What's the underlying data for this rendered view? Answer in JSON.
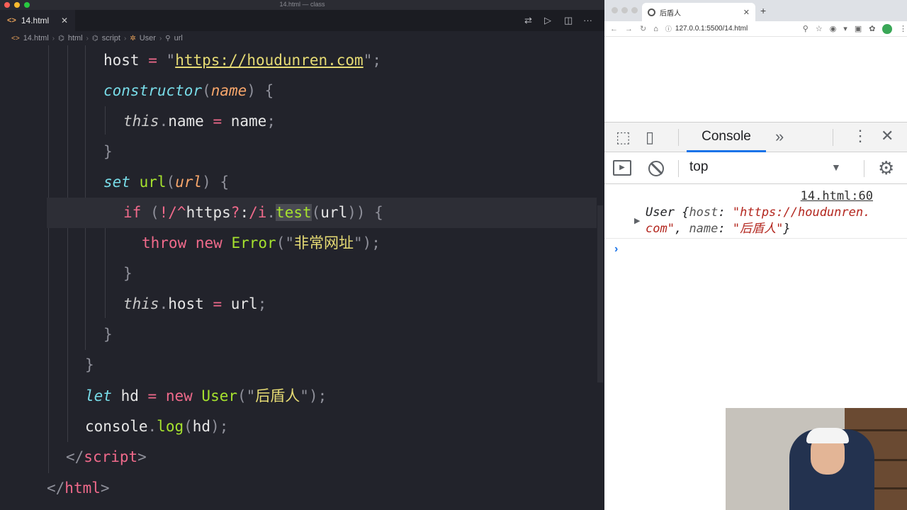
{
  "editor": {
    "window_title": "14.html — class",
    "tab": {
      "icon": "<>",
      "label": "14.html",
      "close": "✕"
    },
    "breadcrumb": [
      "14.html",
      "html",
      "script",
      "User",
      "url"
    ],
    "toolbar_icons": [
      "split-compare-icon",
      "run-icon",
      "split-editor-icon",
      "more-icon"
    ]
  },
  "browser": {
    "tab_title": "后盾人",
    "tab_close": "✕",
    "new_tab": "+",
    "url": "127.0.0.1:5500/14.html"
  },
  "devtools": {
    "active_tab": "Console",
    "more_tabs": "»",
    "context": "top",
    "message": {
      "source": "14.html:60",
      "class_name": "User",
      "props": [
        {
          "key": "host",
          "value": "\"https://houdunren.com\""
        },
        {
          "key": "name",
          "value": "\"后盾人\""
        }
      ]
    },
    "prompt": "›"
  }
}
